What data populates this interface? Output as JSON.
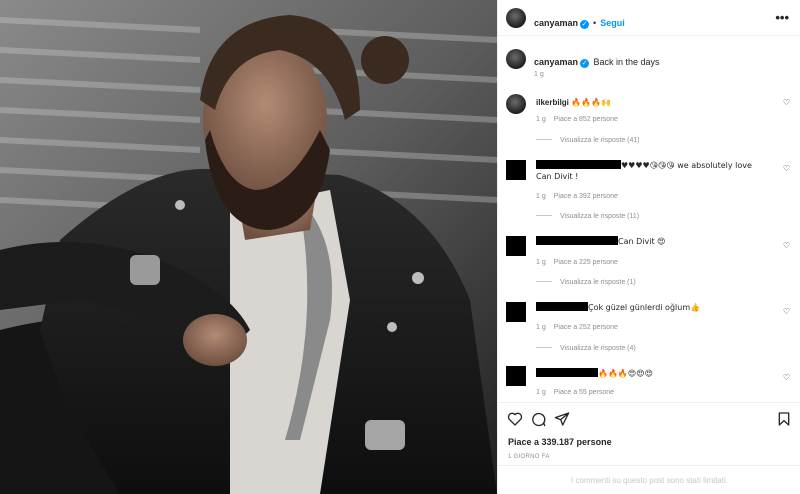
{
  "post": {
    "username": "canyaman",
    "follow_label": "Segui",
    "separator": "•",
    "more_label": "•••",
    "colors": {
      "accent": "#0095f6",
      "text": "#262626",
      "muted": "#8e8e8e",
      "border": "#efefef"
    }
  },
  "caption": {
    "username": "canyaman",
    "text": "Back in the days",
    "time": "1 g"
  },
  "comments": [
    {
      "username": "ilkerbilgi",
      "text": "🔥🔥🔥🙌",
      "time": "1 g",
      "likes": "Piace a 852 persone",
      "replies": "Visualizza le risposte (41)"
    },
    {
      "username": "",
      "text": "♥♥♥♥😘😘😘 we absolutely love Can Divit !",
      "time": "1 g",
      "likes": "Piace a 392 persone",
      "replies": "Visualizza le risposte (11)"
    },
    {
      "username": "",
      "text": "Can Divit 😍",
      "time": "1 g",
      "likes": "Piace a 225 persone",
      "replies": "Visualizza le risposte (1)"
    },
    {
      "username": "",
      "text": "Çok güzel günlerdi oğlum👍",
      "time": "1 g",
      "likes": "Piace a 252 persone",
      "replies": "Visualizza le risposte (4)"
    },
    {
      "username": "",
      "text": "🔥🔥🔥😍😍😍",
      "time": "1 g",
      "likes": "Piace a 55 persone",
      "replies": ""
    }
  ],
  "actions": {
    "like_icon": "heart-icon",
    "comment_icon": "comment-icon",
    "share_icon": "share-icon",
    "save_icon": "bookmark-icon",
    "likes_text": "Piace a 339.187 persone",
    "posted_time": "1 GIORNO FA",
    "limited_text": "I commenti su questo post sono stati limitati."
  }
}
